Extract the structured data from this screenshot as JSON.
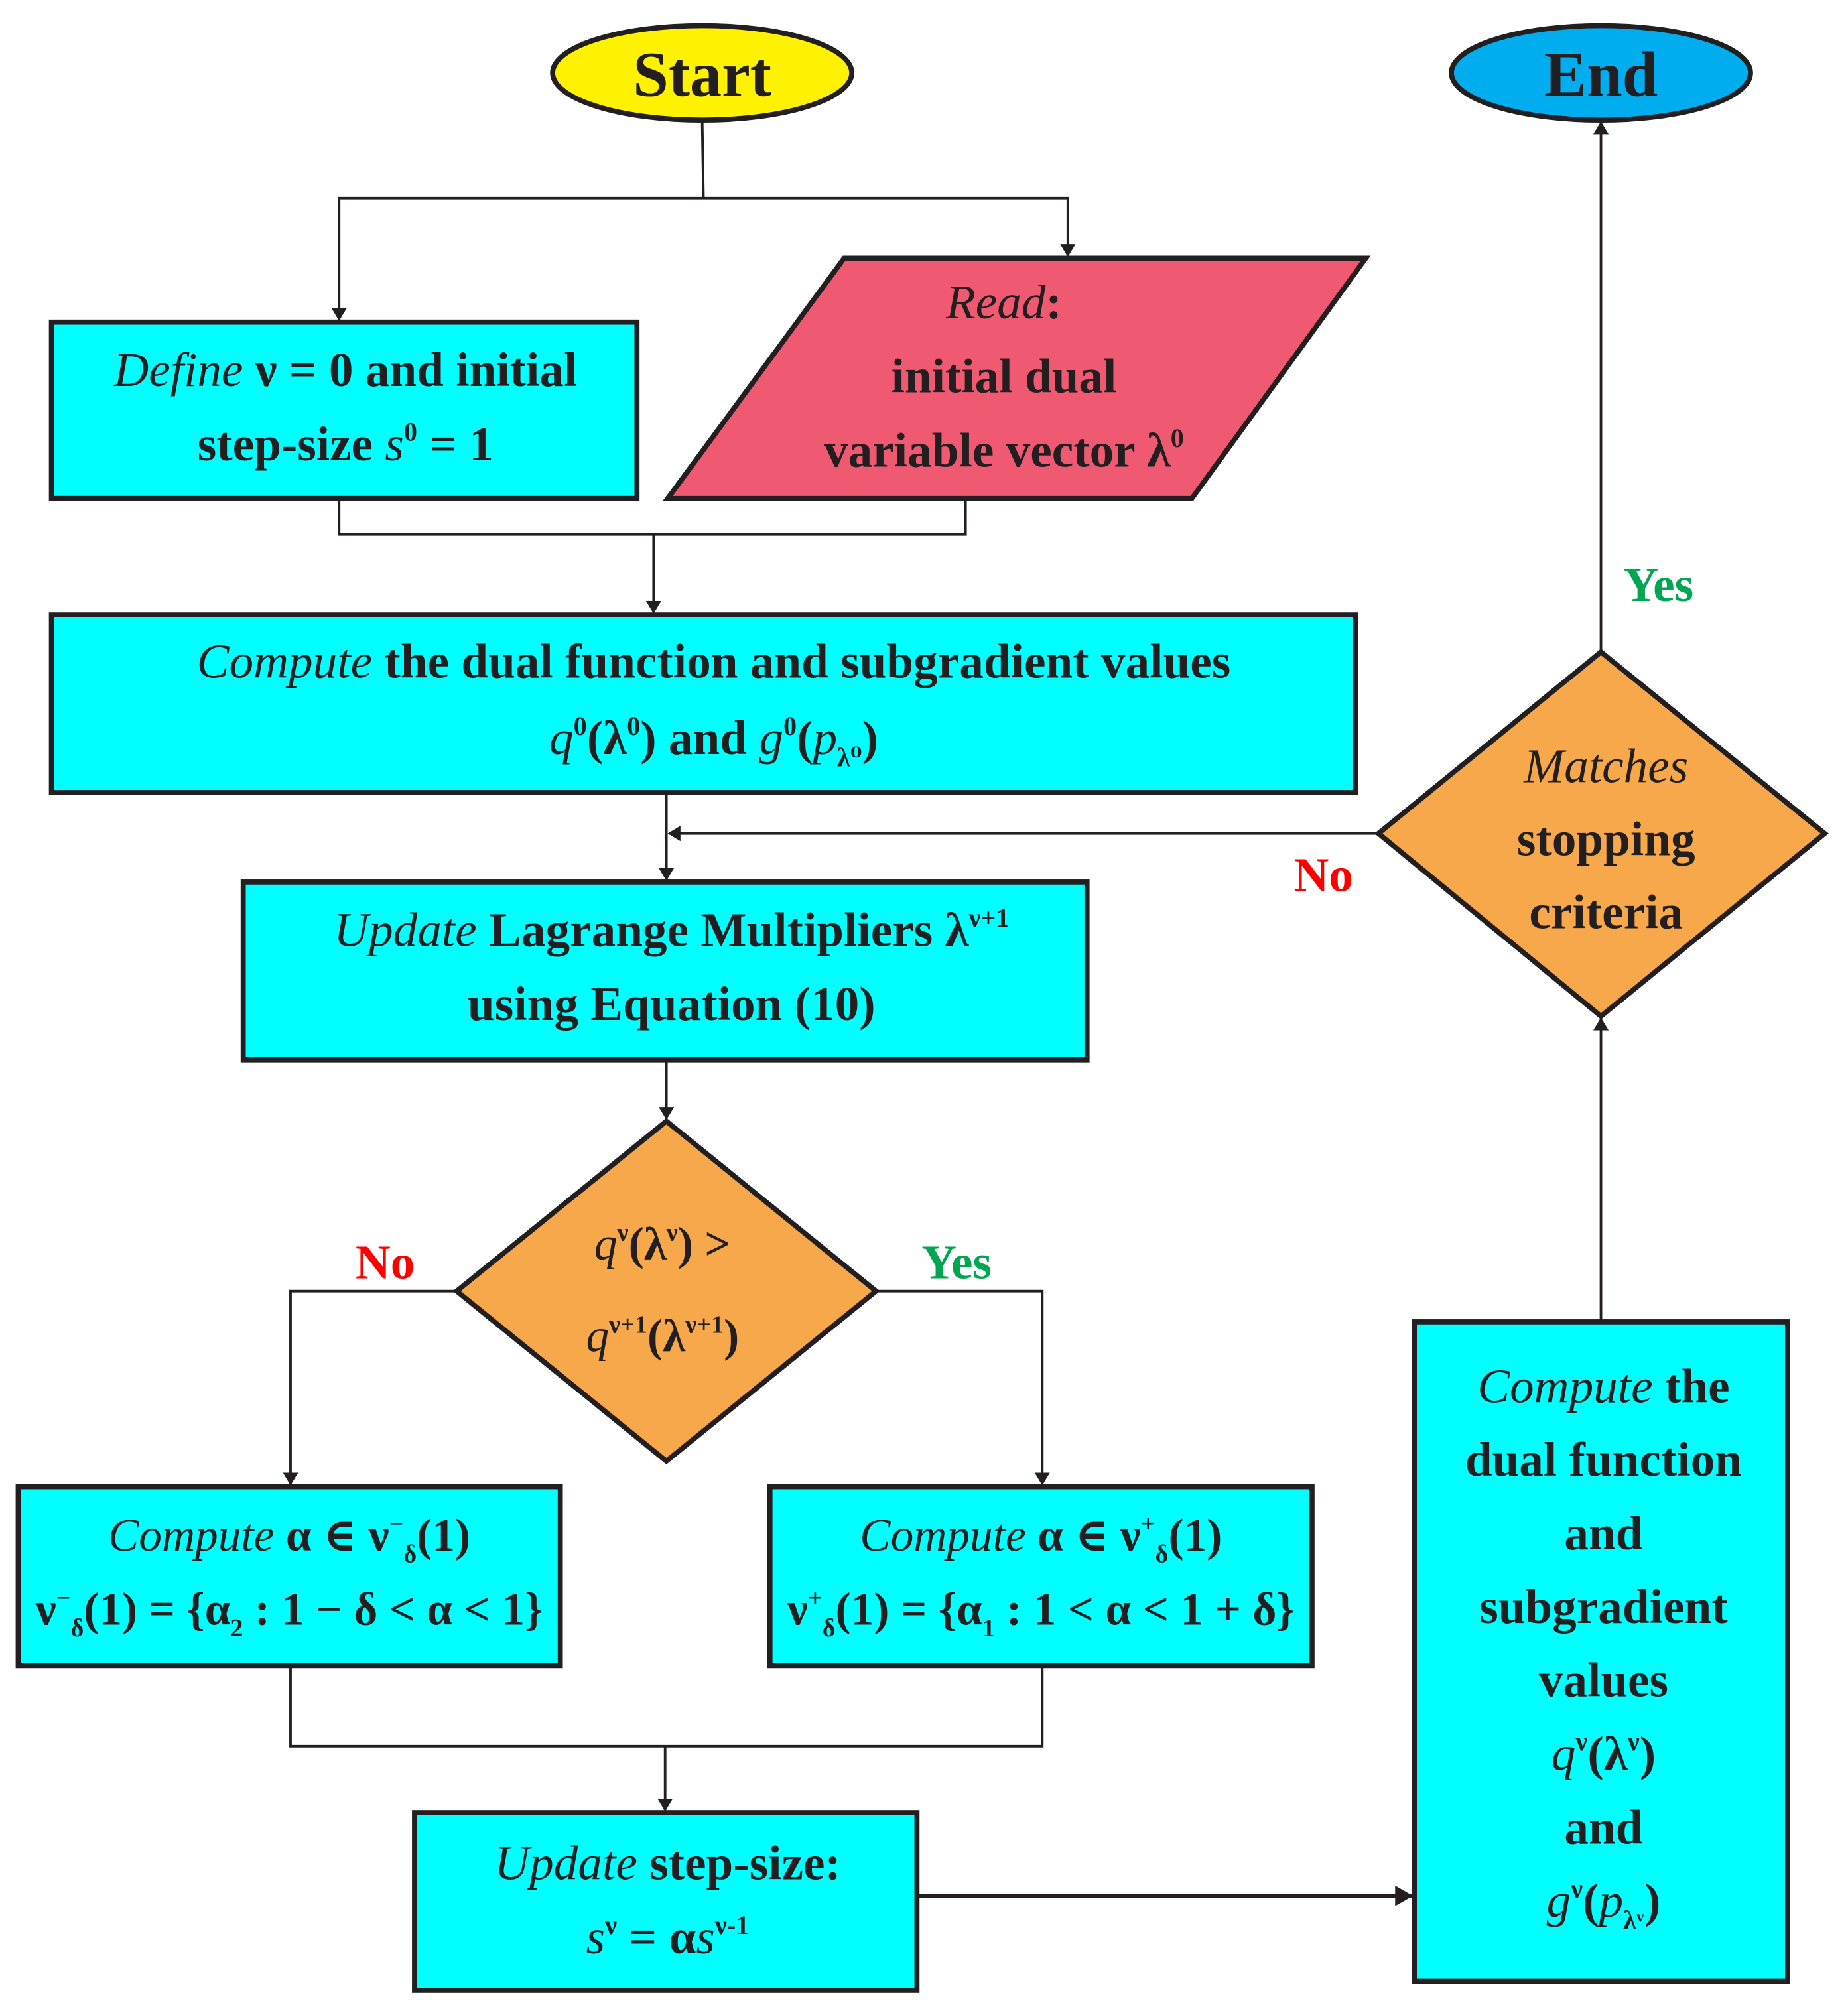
{
  "colors": {
    "start": "#FFF200",
    "end": "#00AEEF",
    "process": "#00FFFF",
    "input": "#EF5A72",
    "decision": "#F7A84A",
    "yes": "#00A651",
    "no": "#FF0000",
    "stroke": "#231F20"
  },
  "nodes": {
    "start": {
      "lines": [
        [
          {
            "t": "Start"
          }
        ]
      ]
    },
    "end": {
      "lines": [
        [
          {
            "t": "End"
          }
        ]
      ]
    },
    "define": {
      "lines": [
        [
          {
            "t": "Define",
            "i": true
          },
          {
            "t": " ν = 0  and initial"
          }
        ],
        [
          {
            "t": "step-size "
          },
          {
            "t": "s",
            "i": true
          },
          {
            "t": "0",
            "sup": true
          },
          {
            "t": " = 1"
          }
        ]
      ]
    },
    "read": {
      "lines": [
        [
          {
            "t": "Read",
            "i": true
          },
          {
            "t": ":"
          }
        ],
        [
          {
            "t": "initial dual"
          }
        ],
        [
          {
            "t": "variable vector λ"
          },
          {
            "t": "0",
            "sup": true
          }
        ]
      ]
    },
    "compute0": {
      "lines": [
        [
          {
            "t": "Compute",
            "i": true
          },
          {
            "t": " the dual function and subgradient values"
          }
        ],
        [
          {
            "t": "q",
            "i": true
          },
          {
            "t": "0",
            "sup": true
          },
          {
            "t": "(λ"
          },
          {
            "t": "0",
            "sup": true
          },
          {
            "t": ")  and  "
          },
          {
            "t": "g",
            "i": true
          },
          {
            "t": "0",
            "sup": true
          },
          {
            "t": "("
          },
          {
            "t": "p",
            "i": true
          },
          {
            "t": "λ⁰",
            "sub": true
          },
          {
            "t": ")"
          }
        ]
      ]
    },
    "update_lagrange": {
      "lines": [
        [
          {
            "t": "Update",
            "i": true
          },
          {
            "t": " Lagrange Multipliers λ"
          },
          {
            "t": "ν+1",
            "sup": true
          }
        ],
        [
          {
            "t": "using Equation (10)"
          }
        ]
      ]
    },
    "compare": {
      "lines": [
        [
          {
            "t": "q",
            "i": true
          },
          {
            "t": "ν",
            "sup": true
          },
          {
            "t": "(λ"
          },
          {
            "t": "ν",
            "sup": true
          },
          {
            "t": ")  >"
          }
        ],
        [
          {
            "t": "q",
            "i": true
          },
          {
            "t": "ν+1",
            "sup": true
          },
          {
            "t": "(λ"
          },
          {
            "t": "ν+1",
            "sup": true
          },
          {
            "t": ")"
          }
        ]
      ]
    },
    "compute_minus": {
      "lines": [
        [
          {
            "t": "Compute",
            "i": true
          },
          {
            "t": "  α ∈ ν"
          },
          {
            "t": "−",
            "sup": true
          },
          {
            "t": "δ",
            "sub": true
          },
          {
            "t": "(1)"
          }
        ],
        [
          {
            "t": "ν"
          },
          {
            "t": "−",
            "sup": true
          },
          {
            "t": "δ",
            "sub": true
          },
          {
            "t": "(1) = {α"
          },
          {
            "t": "2",
            "sub": true
          },
          {
            "t": " : 1 − δ < α < 1}"
          }
        ]
      ]
    },
    "compute_plus": {
      "lines": [
        [
          {
            "t": "Compute",
            "i": true
          },
          {
            "t": " α ∈ ν"
          },
          {
            "t": "+",
            "sup": true
          },
          {
            "t": "δ",
            "sub": true
          },
          {
            "t": "(1)"
          }
        ],
        [
          {
            "t": "ν"
          },
          {
            "t": "+",
            "sup": true
          },
          {
            "t": "δ",
            "sub": true
          },
          {
            "t": "(1) = {α"
          },
          {
            "t": "1",
            "sub": true
          },
          {
            "t": " : 1 < α < 1 + δ}"
          }
        ]
      ]
    },
    "update_step": {
      "lines": [
        [
          {
            "t": "Update",
            "i": true
          },
          {
            "t": " step-size:"
          }
        ],
        [
          {
            "t": "s",
            "i": true
          },
          {
            "t": "ν",
            "sup": true
          },
          {
            "t": " = α"
          },
          {
            "t": "s",
            "i": true
          },
          {
            "t": "ν-1",
            "sup": true
          }
        ]
      ]
    },
    "compute_v": {
      "lines": [
        [
          {
            "t": "Compute",
            "i": true
          },
          {
            "t": " the"
          }
        ],
        [
          {
            "t": "dual function"
          }
        ],
        [
          {
            "t": "and"
          }
        ],
        [
          {
            "t": "subgradient"
          }
        ],
        [
          {
            "t": "values"
          }
        ],
        [
          {
            "t": "q",
            "i": true
          },
          {
            "t": "ν",
            "sup": true
          },
          {
            "t": "(λ"
          },
          {
            "t": "ν",
            "sup": true
          },
          {
            "t": ")"
          }
        ],
        [
          {
            "t": "and"
          }
        ],
        [
          {
            "t": "g",
            "i": true
          },
          {
            "t": "ν",
            "sup": true
          },
          {
            "t": "("
          },
          {
            "t": "p",
            "i": true
          },
          {
            "t": "λᵛ",
            "sub": true
          },
          {
            "t": ")"
          }
        ]
      ]
    },
    "stopping": {
      "lines": [
        [
          {
            "t": "Matches",
            "i": true
          }
        ],
        [
          {
            "t": "stopping"
          }
        ],
        [
          {
            "t": "criteria"
          }
        ]
      ]
    }
  },
  "labels": {
    "compare_no": "No",
    "compare_yes": "Yes",
    "stopping_no": "No",
    "stopping_yes": "Yes"
  }
}
